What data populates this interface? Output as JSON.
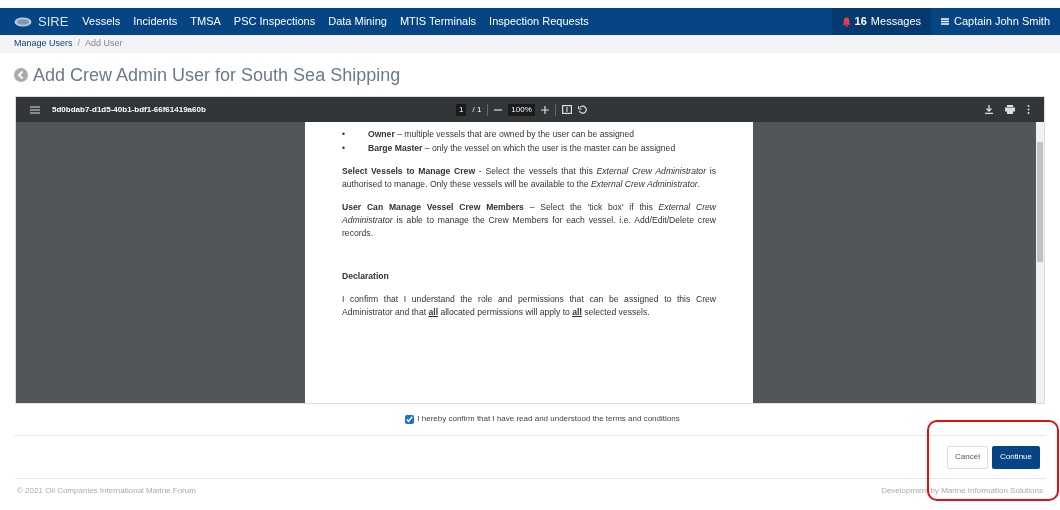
{
  "navbar": {
    "brand": "SIRE",
    "items": [
      "Vessels",
      "Incidents",
      "TMSA",
      "PSC Inspections",
      "Data Mining",
      "MTIS Terminals",
      "Inspection Requests"
    ],
    "messages": {
      "count": "16",
      "label": "Messages"
    },
    "user": "Captain John Smith"
  },
  "breadcrumb": [
    {
      "label": "Manage Users",
      "link": true
    },
    {
      "label": "Add User",
      "link": false
    }
  ],
  "breadcrumb_separator": "/",
  "title": "Add Crew Admin User for South Sea Shipping",
  "pdf_viewer": {
    "filename": "5d0bdab7-d1d5-40b1-bdf1-66f61419a60b",
    "page": "1",
    "pages": "/ 1",
    "zoom": "100%",
    "bullets": [
      {
        "mark": "•",
        "text": "**Owner** – multiple vessels that are owned by the user can be assigned"
      },
      {
        "mark": "•",
        "text": "**Barge Master** – only the vessel on which the user is the master can be assigned"
      }
    ],
    "paragraphs": [
      {
        "kind": "text",
        "text": "**Select Vessels to Manage Crew** - Select the vessels that this *External Crew Administrator* is authorised to manage.  Only these vessels will be available to the *External Crew Administrator*."
      },
      {
        "kind": "text",
        "text": "**User Can Manage Vessel Crew Members** – Select the 'tick box' if this *External Crew Administrator* is able to manage the Crew Members for each vessel. i.e. Add/Edit/Delete crew records."
      },
      {
        "kind": "heading",
        "text": "Declaration"
      },
      {
        "kind": "text",
        "text": "I confirm that I understand the role and permissions that can be assigned to this Crew Administrator and that **all** allocated permissions will apply to **all** selected vessels."
      }
    ]
  },
  "confirm": {
    "label": "I hereby confirm that I have read and understood the terms and conditions",
    "checked": true
  },
  "buttons": [
    {
      "label": "Cancel",
      "kind": "secondary"
    },
    {
      "label": "Continue",
      "kind": "primary"
    }
  ],
  "footer": {
    "left": "© 2021 Oil Companies International Marine Forum",
    "right": "Development by Marine Information Solutions"
  }
}
